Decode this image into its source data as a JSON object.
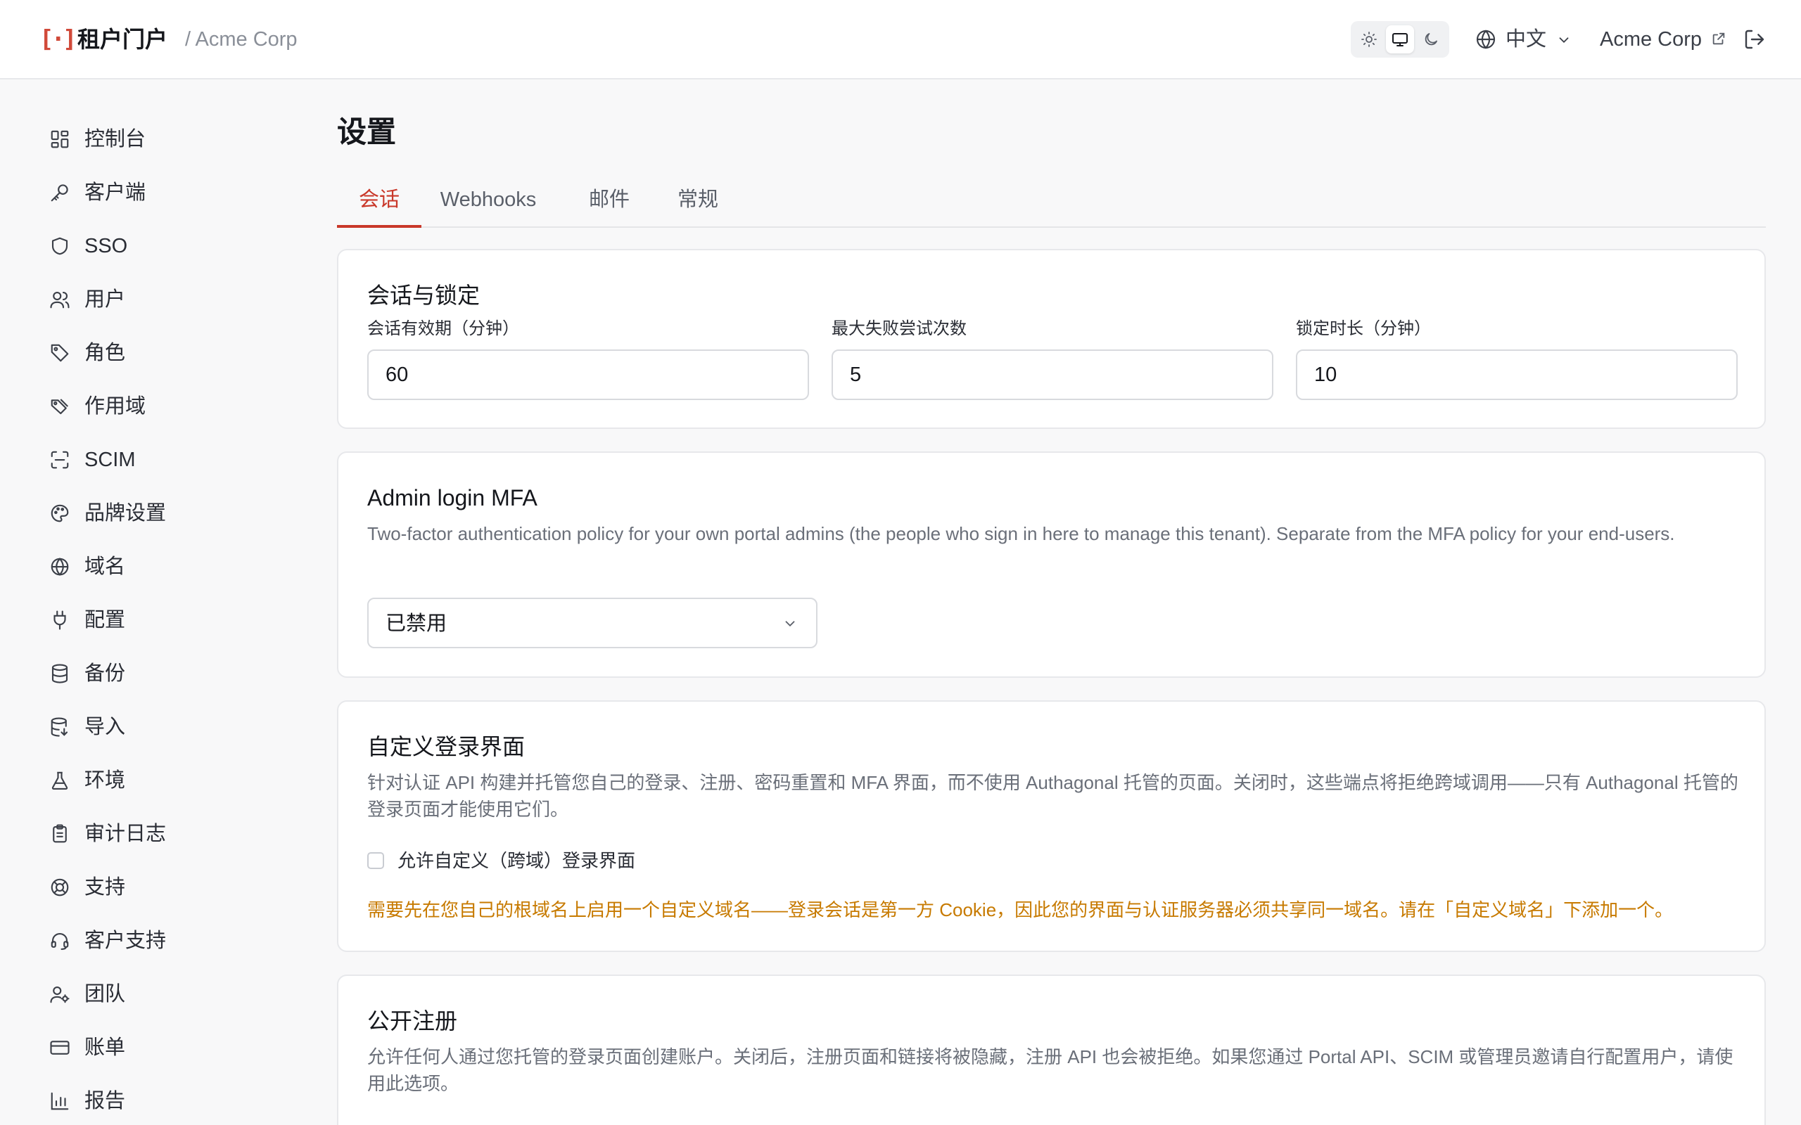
{
  "header": {
    "brand": "租户门户",
    "tenant_crumb": "/ Acme Corp",
    "language": "中文",
    "tenant_link": "Acme Corp"
  },
  "sidebar": {
    "items": [
      {
        "label": "控制台",
        "icon": "dashboard-icon"
      },
      {
        "label": "客户端",
        "icon": "key-icon"
      },
      {
        "label": "SSO",
        "icon": "shield-icon"
      },
      {
        "label": "用户",
        "icon": "users-icon"
      },
      {
        "label": "角色",
        "icon": "tag-icon"
      },
      {
        "label": "作用域",
        "icon": "tags-icon"
      },
      {
        "label": "SCIM",
        "icon": "scan-icon"
      },
      {
        "label": "品牌设置",
        "icon": "palette-icon"
      },
      {
        "label": "域名",
        "icon": "globe-icon"
      },
      {
        "label": "配置",
        "icon": "plug-icon"
      },
      {
        "label": "备份",
        "icon": "database-icon"
      },
      {
        "label": "导入",
        "icon": "database-import-icon"
      },
      {
        "label": "环境",
        "icon": "flask-icon"
      },
      {
        "label": "审计日志",
        "icon": "clipboard-icon"
      },
      {
        "label": "支持",
        "icon": "lifebuoy-icon"
      },
      {
        "label": "客户支持",
        "icon": "headset-icon"
      },
      {
        "label": "团队",
        "icon": "user-cog-icon"
      },
      {
        "label": "账单",
        "icon": "credit-card-icon"
      },
      {
        "label": "报告",
        "icon": "bar-chart-icon"
      }
    ]
  },
  "main": {
    "title": "设置",
    "tabs": [
      {
        "label": "会话",
        "active": true
      },
      {
        "label": "Webhooks",
        "active": false
      },
      {
        "label": "邮件",
        "active": false
      },
      {
        "label": "常规",
        "active": false
      }
    ]
  },
  "session_card": {
    "title": "会话与锁定",
    "fields": [
      {
        "label": "会话有效期（分钟）",
        "value": "60"
      },
      {
        "label": "最大失败尝试次数",
        "value": "5"
      },
      {
        "label": "锁定时长（分钟）",
        "value": "10"
      }
    ]
  },
  "mfa_card": {
    "title": "Admin login MFA",
    "description": "Two-factor authentication policy for your own portal admins (the people who sign in here to manage this tenant). Separate from the MFA policy for your end-users.",
    "select_value": "已禁用"
  },
  "custom_login_card": {
    "title": "自定义登录界面",
    "description": "针对认证 API 构建并托管您自己的登录、注册、密码重置和 MFA 界面，而不使用 Authagonal 托管的页面。关闭时，这些端点将拒绝跨域调用——只有 Authagonal 托管的登录页面才能使用它们。",
    "checkbox_label": "允许自定义（跨域）登录界面",
    "checked": false,
    "warning": "需要先在您自己的根域名上启用一个自定义域名——登录会话是第一方 Cookie，因此您的界面与认证服务器必须共享同一域名。请在「自定义域名」下添加一个。"
  },
  "signup_card": {
    "title": "公开注册",
    "description": "允许任何人通过您托管的登录页面创建账户。关闭后，注册页面和链接将被隐藏，注册 API 也会被拒绝。如果您通过 Portal API、SCIM 或管理员邀请自行配置用户，请使用此选项。"
  },
  "colors": {
    "accent": "#c9382a",
    "warning": "#c77a00"
  }
}
